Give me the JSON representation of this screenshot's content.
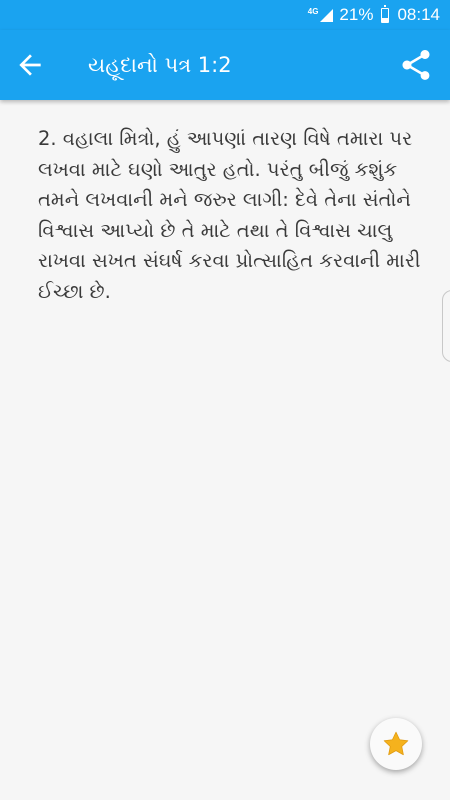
{
  "status_bar": {
    "network": "4G",
    "battery": "21%",
    "time": "08:14"
  },
  "header": {
    "back_icon": "arrow-left-icon",
    "title": "યહૂદાનો પત્ર 1:2",
    "share_icon": "share-icon"
  },
  "content": {
    "verse_text": "2. વહાલા મિત્રો, હું આપણાં તારણ વિષે તમારા પર લખવા માટે ઘણો આતુર હતો. પરંતુ બીજું કશુંક તમને લખવાની મને જરુર લાગી: દેવે તેના સંતોને વિશ્વાસ આપ્યો છે તે માટે તથા તે વિશ્વાસ ચાલુ રાખવા સખત સંઘર્ષ કરવા પ્રોત્સાહિત કરવાની મારી ઈચ્છા છે."
  },
  "fab": {
    "icon": "star-icon",
    "color": "#f5b21d"
  },
  "colors": {
    "primary": "#1aa3f0",
    "background": "#f6f6f6",
    "text": "#3a3a3a"
  }
}
